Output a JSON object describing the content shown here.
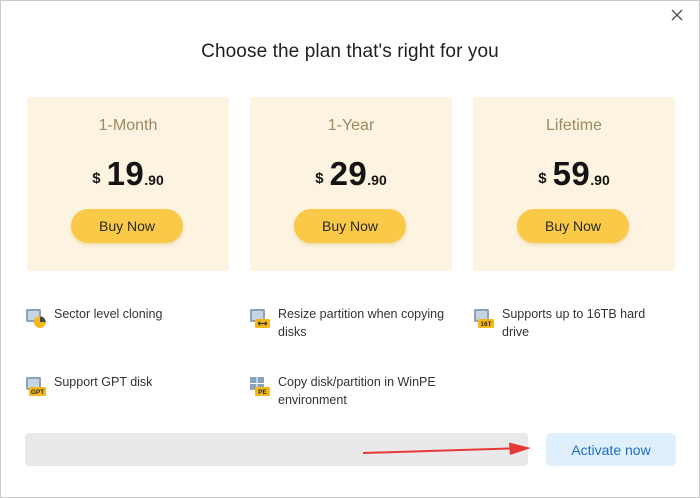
{
  "dialog": {
    "title": "Choose the plan that's right for you"
  },
  "plans": [
    {
      "name": "1-Month",
      "currency": "$",
      "price_main": "19",
      "price_decimal": ".90",
      "button": "Buy Now"
    },
    {
      "name": "1-Year",
      "currency": "$",
      "price_main": "29",
      "price_decimal": ".90",
      "button": "Buy Now"
    },
    {
      "name": "Lifetime",
      "currency": "$",
      "price_main": "59",
      "price_decimal": ".90",
      "button": "Buy Now"
    }
  ],
  "features": [
    {
      "icon": "sector-clone-icon",
      "label": "Sector level cloning"
    },
    {
      "icon": "resize-partition-icon",
      "label": "Resize partition when copying disks"
    },
    {
      "icon": "16tb-disk-icon",
      "icon_text": "16T",
      "label": "Supports up to 16TB hard drive"
    },
    {
      "icon": "gpt-disk-icon",
      "icon_text": "GPT",
      "label": "Support GPT disk"
    },
    {
      "icon": "winpe-icon",
      "icon_text": "PE",
      "label": "Copy disk/partition in WinPE environment"
    }
  ],
  "activation": {
    "button": "Activate now"
  },
  "colors": {
    "plan_bg": "#fdf3e1",
    "buy_button": "#f9c947",
    "plan_name": "#9b8a63",
    "activate_bg": "#dff0fc",
    "activate_text": "#1e6fc2",
    "arrow": "#e53935"
  }
}
